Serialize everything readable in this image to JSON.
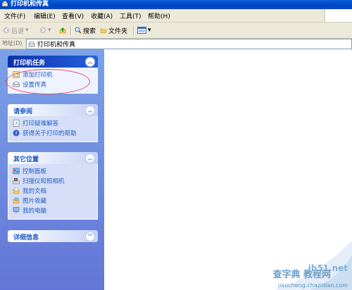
{
  "window": {
    "title": "打印机和传真"
  },
  "menu": [
    "文件(F)",
    "编辑(E)",
    "查看(V)",
    "收藏(A)",
    "工具(T)",
    "帮助(H)"
  ],
  "toolbar": {
    "back": "后退",
    "search": "搜索",
    "folders": "文件夹"
  },
  "address": {
    "label": "地址(D)",
    "value": "打印机和传真"
  },
  "panels": {
    "printer_tasks": {
      "title": "打印机任务",
      "items": [
        "添加打印机",
        "设置传真"
      ]
    },
    "see_also": {
      "title": "请参阅",
      "items": [
        "打印疑难解答",
        "获得关于打印的帮助"
      ]
    },
    "other_places": {
      "title": "其它位置",
      "items": [
        "控制面板",
        "扫描仪和照相机",
        "我的文档",
        "图片收藏",
        "我的电脑"
      ]
    },
    "details": {
      "title": "详细信息"
    }
  },
  "watermark": {
    "line1": "jb51.net",
    "line2": "查字典 教程网",
    "line3": "jiaocheng.chazidian.com"
  }
}
